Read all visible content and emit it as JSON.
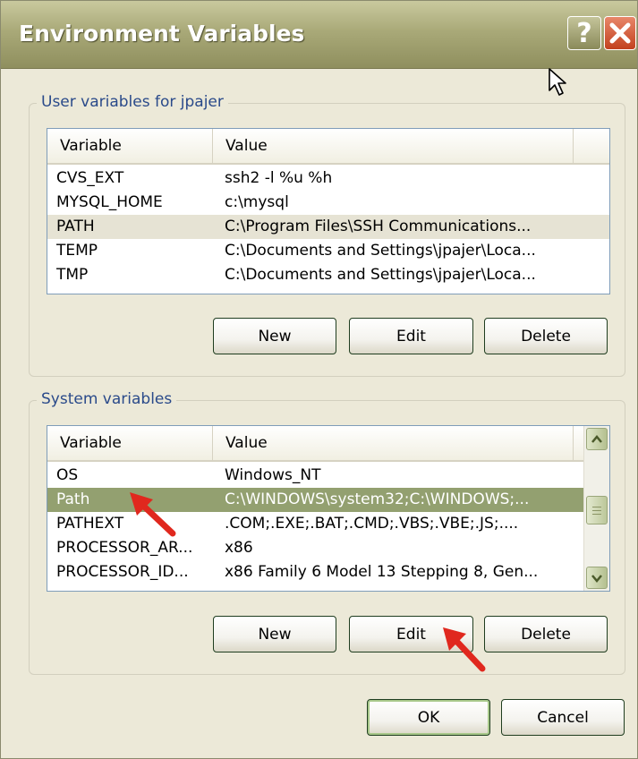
{
  "window": {
    "title": "Environment Variables",
    "help_glyph": "?",
    "close_glyph": "×"
  },
  "user_vars": {
    "legend": "User variables for jpajer",
    "columns": {
      "variable": "Variable",
      "value": "Value"
    },
    "rows": [
      {
        "variable": "CVS_EXT",
        "value": "ssh2 -l %u %h"
      },
      {
        "variable": "MYSQL_HOME",
        "value": "c:\\mysql"
      },
      {
        "variable": "PATH",
        "value": "C:\\Program Files\\SSH Communications..."
      },
      {
        "variable": "TEMP",
        "value": "C:\\Documents and Settings\\jpajer\\Loca..."
      },
      {
        "variable": "TMP",
        "value": "C:\\Documents and Settings\\jpajer\\Loca..."
      }
    ],
    "buttons": {
      "new": "New",
      "edit": "Edit",
      "delete": "Delete"
    }
  },
  "system_vars": {
    "legend": "System variables",
    "columns": {
      "variable": "Variable",
      "value": "Value"
    },
    "rows": [
      {
        "variable": "OS",
        "value": "Windows_NT"
      },
      {
        "variable": "Path",
        "value": "C:\\WINDOWS\\system32;C:\\WINDOWS;..."
      },
      {
        "variable": "PATHEXT",
        "value": ".COM;.EXE;.BAT;.CMD;.VBS;.VBE;.JS;...."
      },
      {
        "variable": "PROCESSOR_AR...",
        "value": "x86"
      },
      {
        "variable": "PROCESSOR_ID...",
        "value": "x86 Family 6 Model 13 Stepping 8, Gen..."
      }
    ],
    "buttons": {
      "new": "New",
      "edit": "Edit",
      "delete": "Delete"
    }
  },
  "footer": {
    "ok": "OK",
    "cancel": "Cancel"
  },
  "colors": {
    "window_bg": "#ECE9D8",
    "selection_active": "#93A070",
    "arrow": "#E0281E"
  }
}
